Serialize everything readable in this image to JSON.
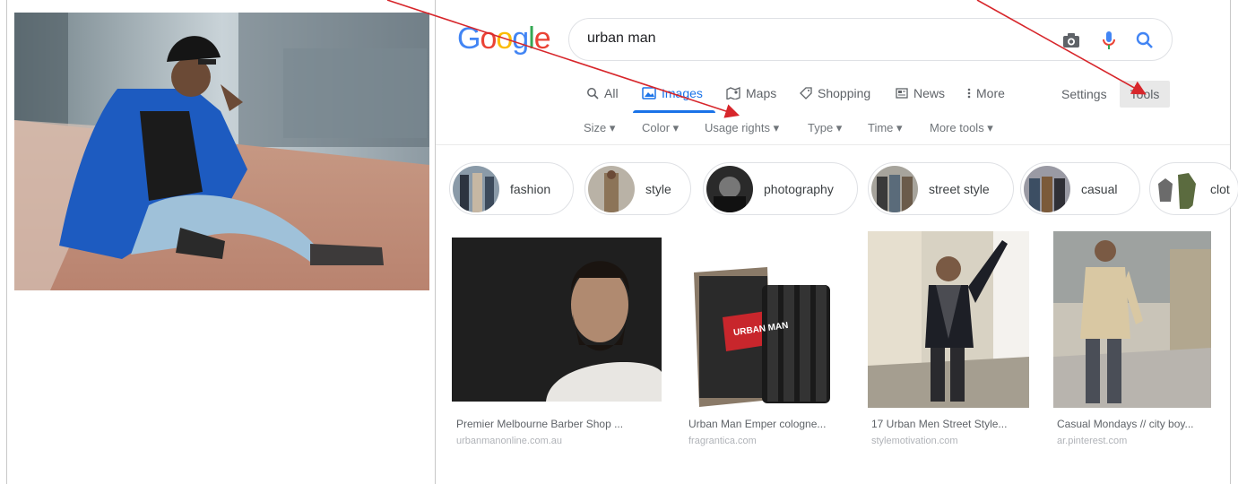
{
  "search": {
    "logo": [
      "G",
      "o",
      "o",
      "g",
      "l",
      "e"
    ],
    "query": "urban man"
  },
  "tabs": [
    {
      "label": "All",
      "icon": "search-icon"
    },
    {
      "label": "Images",
      "icon": "image-icon"
    },
    {
      "label": "Maps",
      "icon": "map-icon"
    },
    {
      "label": "Shopping",
      "icon": "tag-icon"
    },
    {
      "label": "News",
      "icon": "news-icon"
    },
    {
      "label": "More",
      "icon": "kebab-icon"
    }
  ],
  "settings_label": "Settings",
  "tools_label": "Tools",
  "filters": [
    "Size ▾",
    "Color ▾",
    "Usage rights ▾",
    "Type ▾",
    "Time ▾",
    "More tools ▾"
  ],
  "chips": [
    "fashion",
    "style",
    "photography",
    "street style",
    "casual",
    "clot"
  ],
  "results": [
    {
      "title": "Premier Melbourne Barber Shop ...",
      "source": "urbanmanonline.com.au"
    },
    {
      "title": "Urban Man Emper cologne...",
      "source": "fragrantica.com"
    },
    {
      "title": "17 Urban Men Street Style...",
      "source": "stylemotivation.com"
    },
    {
      "title": "Casual Mondays // city boy...",
      "source": "ar.pinterest.com"
    }
  ],
  "bottle_label": "URBAN MAN",
  "colors": {
    "blue": "#4285f4",
    "red": "#ea4335",
    "yellow": "#fbbc05",
    "green": "#34a853",
    "active_tab": "#1a73e8",
    "arrow": "#d7262b"
  }
}
